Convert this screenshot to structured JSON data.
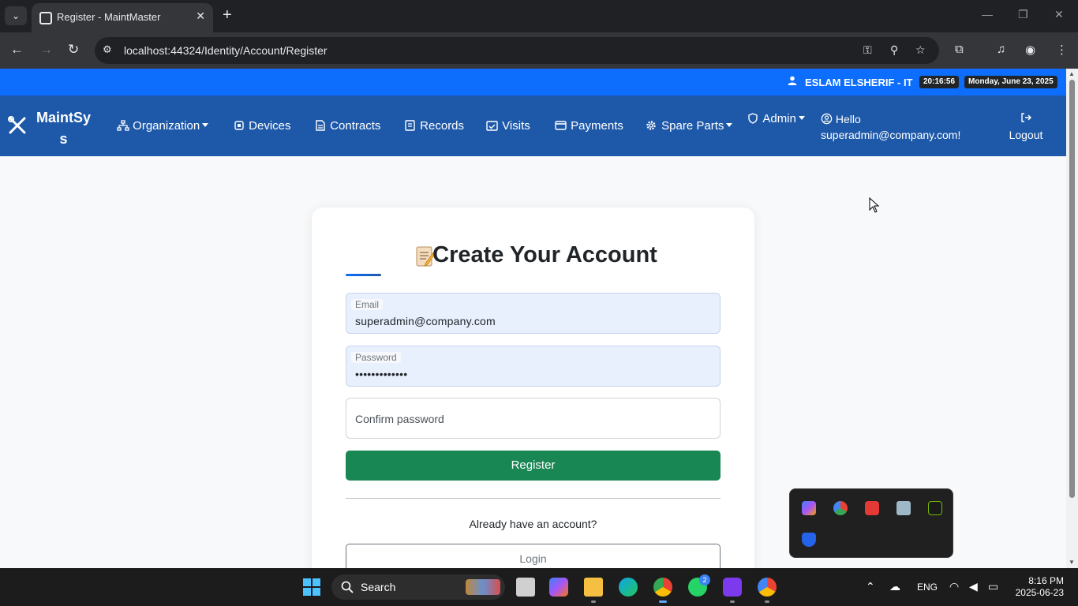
{
  "browser": {
    "tab_title": "Register - MaintMaster",
    "url": "localhost:44324/Identity/Account/Register"
  },
  "topbar": {
    "user": "ESLAM ELSHERIF - IT",
    "time": "20:16:56",
    "date": "Monday, June 23, 2025"
  },
  "nav": {
    "brand_line1": "MaintSy",
    "brand_line2": "s",
    "items": {
      "organization": "Organization",
      "devices": "Devices",
      "contracts": "Contracts",
      "records": "Records",
      "visits": "Visits",
      "payments": "Payments",
      "spare_parts": "Spare Parts",
      "admin": "Admin"
    },
    "hello": "Hello",
    "hello_user": "superadmin@company.com!",
    "logout": "Logout"
  },
  "form": {
    "title": "Create Your Account",
    "email_label": "Email",
    "email_value": "superadmin@company.com",
    "password_label": "Password",
    "password_value": "•••••••••••••",
    "confirm_placeholder": "Confirm password",
    "register_button": "Register",
    "already": "Already have an account?",
    "login_button": "Login"
  },
  "taskbar": {
    "search": "Search",
    "lang": "ENG",
    "time": "8:16 PM",
    "date": "2025-06-23",
    "whatsapp_badge": "2"
  },
  "colors": {
    "topbar": "#0d6efd",
    "navbar": "#1e59a9",
    "register": "#198754"
  },
  "icons": [
    "tools-icon",
    "sitemap-icon",
    "cpu-icon",
    "file-icon",
    "list-icon",
    "calendar-check-icon",
    "credit-card-icon",
    "gear-icon",
    "shield-icon",
    "user-circle-icon",
    "logout-icon",
    "memo-icon"
  ]
}
